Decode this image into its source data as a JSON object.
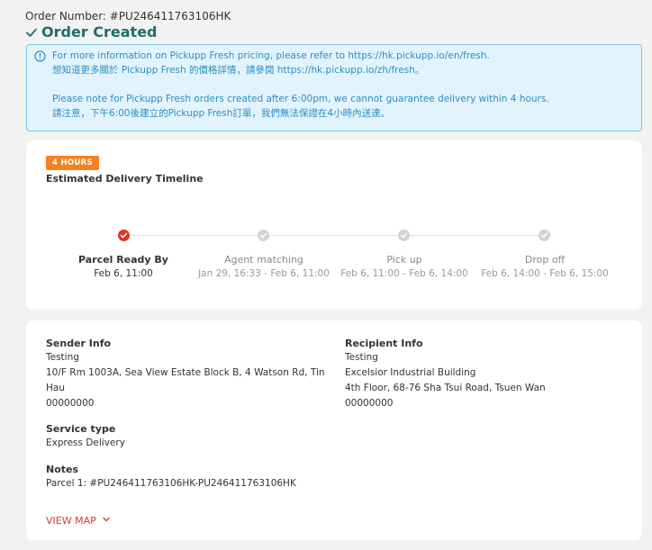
{
  "order": {
    "number_text": "Order Number: #PU246411763106HK",
    "status": "Order Created"
  },
  "info_notice": {
    "line1": "For more information on Pickupp Fresh pricing, please refer to https://hk.pickupp.io/en/fresh.",
    "line2": "想知道更多關於 Pickupp Fresh 的價格詳情，請參閱 https://hk.pickupp.io/zh/fresh。",
    "line3": "Please note for Pickupp Fresh orders created after 6:00pm, we cannot guarantee delivery within 4 hours.",
    "line4": "請注意，下午6:00後建立的Pickupp Fresh訂單，我們無法保證在4小時內送達。"
  },
  "timeline": {
    "badge": "4 HOURS",
    "title": "Estimated Delivery Timeline",
    "steps": [
      {
        "label": "Parcel Ready By",
        "time": "Feb 6, 11:00",
        "state": "done"
      },
      {
        "label": "Agent matching",
        "time": "Jan 29, 16:33 - Feb 6, 11:00",
        "state": "pending"
      },
      {
        "label": "Pick up",
        "time": "Feb 6, 11:00 - Feb 6, 14:00",
        "state": "pending"
      },
      {
        "label": "Drop off",
        "time": "Feb 6, 14:00 - Feb 6, 15:00",
        "state": "pending"
      }
    ]
  },
  "sender": {
    "label": "Sender Info",
    "name": "Testing",
    "address_line1": "10/F Rm 1003A, Sea View Estate Block B, 4 Watson Rd, Tin",
    "address_line2": "Hau",
    "phone": "00000000"
  },
  "recipient": {
    "label": "Recipient Info",
    "name": "Testing",
    "address_line1": "Excelsior Industrial Building",
    "address_line2": "4th Floor, 68-76 Sha Tsui Road, Tsuen Wan",
    "phone": "00000000"
  },
  "service": {
    "label": "Service type",
    "value": "Express Delivery"
  },
  "notes": {
    "label": "Notes",
    "value": "Parcel 1: #PU246411763106HK-PU246411763106HK"
  },
  "actions": {
    "view_map": "VIEW MAP"
  },
  "colors": {
    "accent_red": "#e0362b",
    "badge_orange": "#f5821f",
    "status_teal": "#1f6f6a",
    "info_blue": "#2b8fc5",
    "info_bg": "#e3f3fb"
  }
}
